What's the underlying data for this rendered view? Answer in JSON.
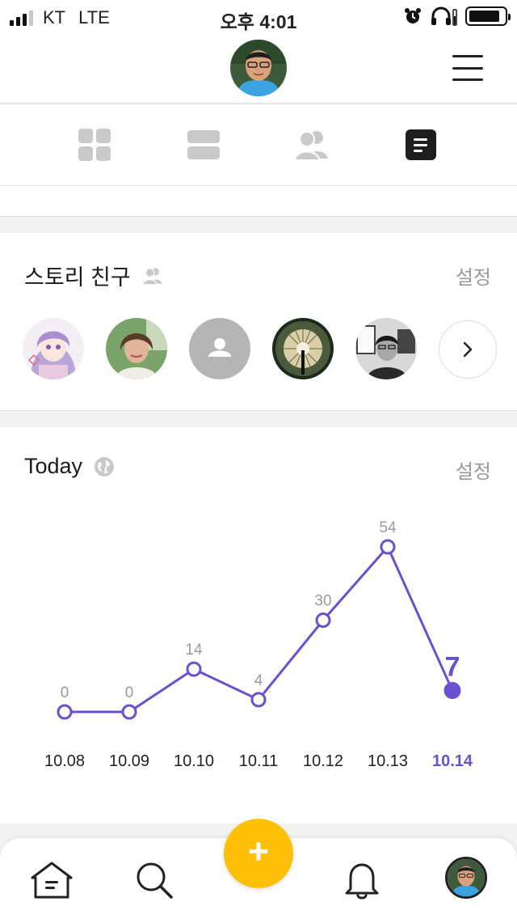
{
  "status_bar": {
    "carrier": "KT",
    "network": "LTE",
    "time": "오후 4:01"
  },
  "header": {
    "profile_icon": "user-avatar",
    "menu_icon": "hamburger-icon"
  },
  "tabs": [
    {
      "name": "grid-view",
      "icon": "grid-icon",
      "active": false
    },
    {
      "name": "list-view",
      "icon": "list-icon",
      "active": false
    },
    {
      "name": "friends",
      "icon": "people-icon",
      "active": false
    },
    {
      "name": "stats",
      "icon": "document-icon",
      "active": true
    }
  ],
  "story_friends": {
    "title": "스토리 친구",
    "setting_label": "설정",
    "friends": [
      "anime-avatar",
      "woman-avatar",
      "default-avatar",
      "dome-avatar",
      "man-bw-avatar"
    ]
  },
  "today": {
    "title": "Today",
    "setting_label": "설정"
  },
  "chart_data": {
    "type": "line",
    "title": "Today",
    "categories": [
      "10.08",
      "10.09",
      "10.10",
      "10.11",
      "10.12",
      "10.13",
      "10.14"
    ],
    "values": [
      0,
      0,
      14,
      4,
      30,
      54,
      7
    ],
    "highlight_index": 6,
    "highlight_label": "7",
    "color": "#6a4fcf",
    "label_color": "#9a9a9a"
  },
  "bottom_nav": {
    "items": [
      "home-icon",
      "search-icon",
      "add-icon",
      "bell-icon",
      "profile-icon"
    ],
    "fab_label": "+",
    "fab_color": "#ffc107"
  },
  "colors": {
    "accent": "#6a4fcf",
    "fab": "#ffc107",
    "muted": "#9a9a9a"
  }
}
